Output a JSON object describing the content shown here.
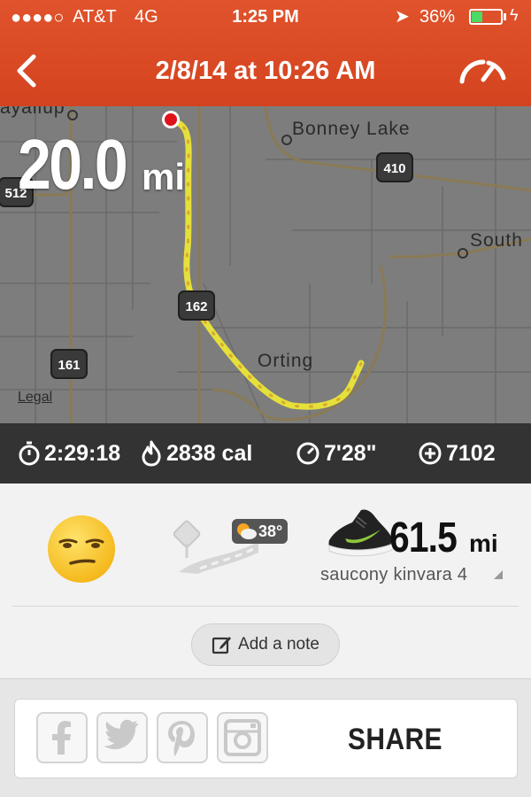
{
  "status_bar": {
    "signal": "●●●●○",
    "carrier": "AT&T",
    "network": "4G",
    "time": "1:25 PM",
    "battery_percent": "36%",
    "battery_level": 0.36
  },
  "nav": {
    "title": "2/8/14 at 10:26 AM"
  },
  "map": {
    "labels": {
      "top_left_partial": "ayallup",
      "bonney_lake": "Bonney Lake",
      "south": "South",
      "orting": "Orting"
    },
    "shields": {
      "r512": "512",
      "r410": "410",
      "r162": "162",
      "r161": "161"
    },
    "legal": "Legal"
  },
  "run": {
    "distance_value": "20.0",
    "distance_unit": "mi"
  },
  "stats": {
    "duration": "2:29:18",
    "calories": "2838 cal",
    "pace": "7'28\"",
    "fuel": "7102"
  },
  "details": {
    "weather_temp": "38°",
    "shoe_distance_value": "61.5",
    "shoe_distance_unit": "mi",
    "shoe_name": "saucony kinvara 4",
    "add_note_label": "Add a note"
  },
  "share": {
    "label": "SHARE",
    "icons": [
      "facebook-icon",
      "twitter-icon",
      "pinterest-icon",
      "instagram-icon"
    ]
  },
  "colors": {
    "header": "#d9491f",
    "route": "#e5e03a",
    "stats_bar": "#333333",
    "map_bg": "#7d7d7d",
    "nike_swoosh": "#8cc63f"
  }
}
